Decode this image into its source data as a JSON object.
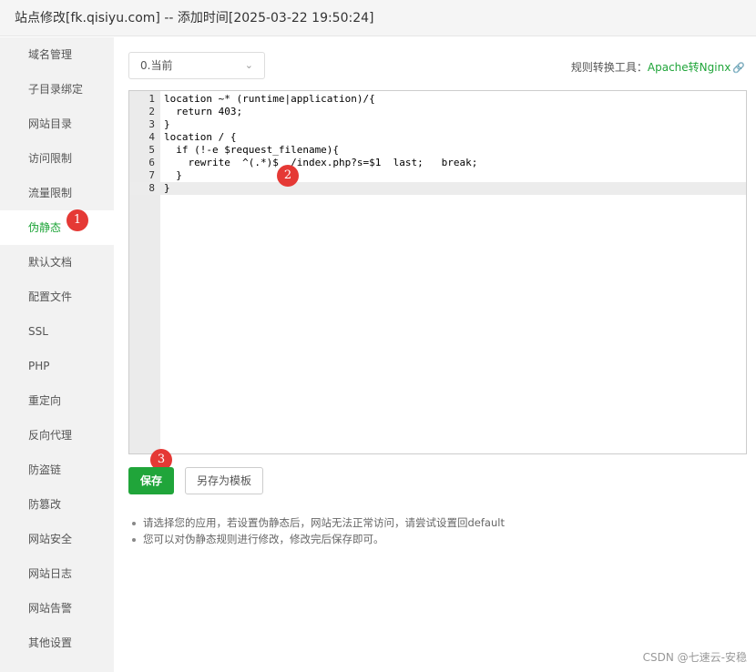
{
  "window": {
    "title": "站点修改[fk.qisiyu.com] -- 添加时间[2025-03-22 19:50:24]"
  },
  "sidebar": {
    "items": [
      {
        "label": "域名管理"
      },
      {
        "label": "子目录绑定"
      },
      {
        "label": "网站目录"
      },
      {
        "label": "访问限制"
      },
      {
        "label": "流量限制"
      },
      {
        "label": "伪静态",
        "active": true
      },
      {
        "label": "默认文档"
      },
      {
        "label": "配置文件"
      },
      {
        "label": "SSL"
      },
      {
        "label": "PHP"
      },
      {
        "label": "重定向"
      },
      {
        "label": "反向代理"
      },
      {
        "label": "防盗链"
      },
      {
        "label": "防篡改"
      },
      {
        "label": "网站安全"
      },
      {
        "label": "网站日志"
      },
      {
        "label": "网站告警"
      },
      {
        "label": "其他设置"
      }
    ]
  },
  "rewrite": {
    "selected": "0.当前",
    "tool_label": "规则转换工具：",
    "tool_link": "Apache转Nginx",
    "tool_link_icon": "link-icon"
  },
  "editor": {
    "lines": [
      {
        "n": "1",
        "text": "location ~* (runtime|application)/{"
      },
      {
        "n": "2",
        "text": "  return 403;"
      },
      {
        "n": "3",
        "text": "}"
      },
      {
        "n": "4",
        "text": "location / {"
      },
      {
        "n": "5",
        "text": "  if (!-e $request_filename){"
      },
      {
        "n": "6",
        "text": "    rewrite  ^(.*)$  /index.php?s=$1  last;   break;"
      },
      {
        "n": "7",
        "text": "  }"
      },
      {
        "n": "8",
        "text": "}"
      }
    ],
    "current_line": "8"
  },
  "buttons": {
    "save": "保存",
    "save_template": "另存为模板"
  },
  "tips": [
    "请选择您的应用，若设置伪静态后，网站无法正常访问，请尝试设置回default",
    "您可以对伪静态规则进行修改，修改完后保存即可。"
  ],
  "annotations": [
    "1",
    "2",
    "3"
  ],
  "watermark": "CSDN @七速云-安稳",
  "colors": {
    "accent": "#20a53a",
    "badge": "#e53935"
  }
}
